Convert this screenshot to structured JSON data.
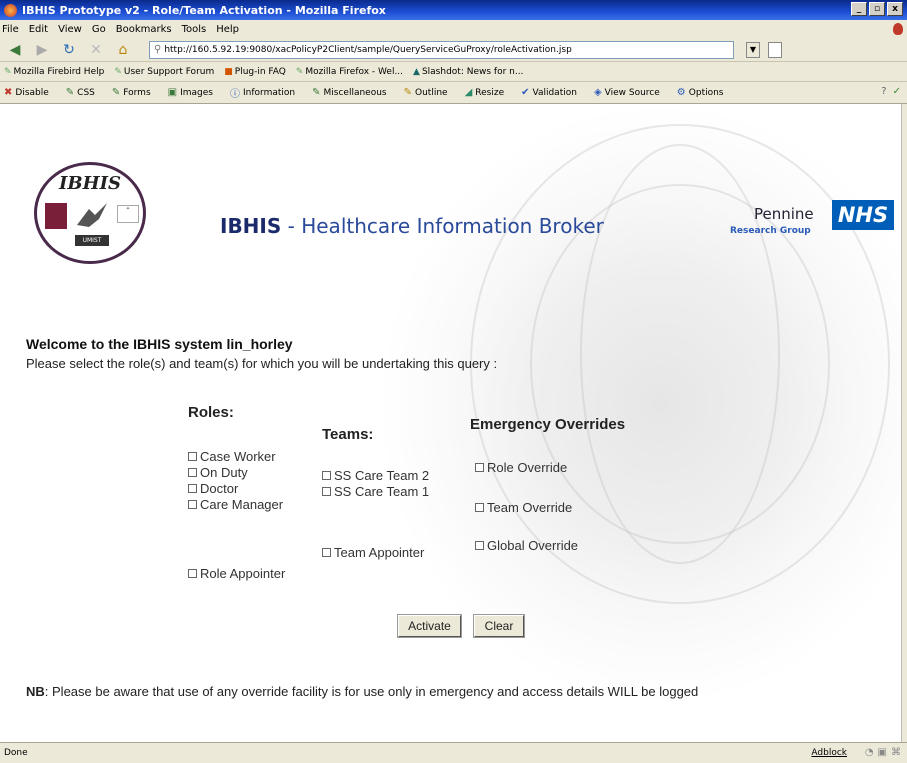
{
  "window": {
    "title": "IBHIS Prototype v2 - Role/Team Activation - Mozilla Firefox",
    "controls": [
      "_",
      "▫",
      "x"
    ]
  },
  "menu": [
    "File",
    "Edit",
    "View",
    "Go",
    "Bookmarks",
    "Tools",
    "Help"
  ],
  "nav": {
    "url": "http://160.5.92.19:9080/xacPolicyP2Client/sample/QueryServiceGuProxy/roleActivation.jsp",
    "go_label": "▼"
  },
  "bookmarks": [
    "Mozilla Firebird Help",
    "User Support Forum",
    "Plug-in FAQ",
    "Mozilla Firefox - Wel...",
    "Slashdot: News for n..."
  ],
  "devtools": {
    "items": [
      "Disable",
      "CSS",
      "Forms",
      "Images",
      "Information",
      "Miscellaneous",
      "Outline",
      "Resize",
      "Validation",
      "View Source",
      "Options"
    ]
  },
  "header": {
    "logo_text": "IBHIS",
    "logo_umist": "UMIST",
    "brand": "IBHIS",
    "subtitle": " - Healthcare Information Broker",
    "pennine": "Pennine",
    "nhs": "NHS",
    "research_group": "Research Group"
  },
  "welcome": "Welcome to the IBHIS system lin_horley",
  "instruction": "Please select the role(s) and team(s) for which you will be undertaking this query :",
  "roles": {
    "heading": "Roles:",
    "items": [
      "Case Worker",
      "On Duty",
      "Doctor",
      "Care Manager",
      "Role Appointer"
    ]
  },
  "teams": {
    "heading": "Teams:",
    "items": [
      "SS Care Team 2",
      "SS Care Team 1",
      "Team Appointer"
    ]
  },
  "overrides": {
    "heading": "Emergency Overrides",
    "items": [
      "Role Override",
      "Team Override",
      "Global Override"
    ]
  },
  "buttons": {
    "activate": "Activate",
    "clear": "Clear"
  },
  "note": {
    "prefix": "NB",
    "text": ": Please be aware that use of any override facility is for use only in emergency and access details WILL be logged"
  },
  "status": {
    "text": "Done",
    "adblock": "Adblock"
  }
}
